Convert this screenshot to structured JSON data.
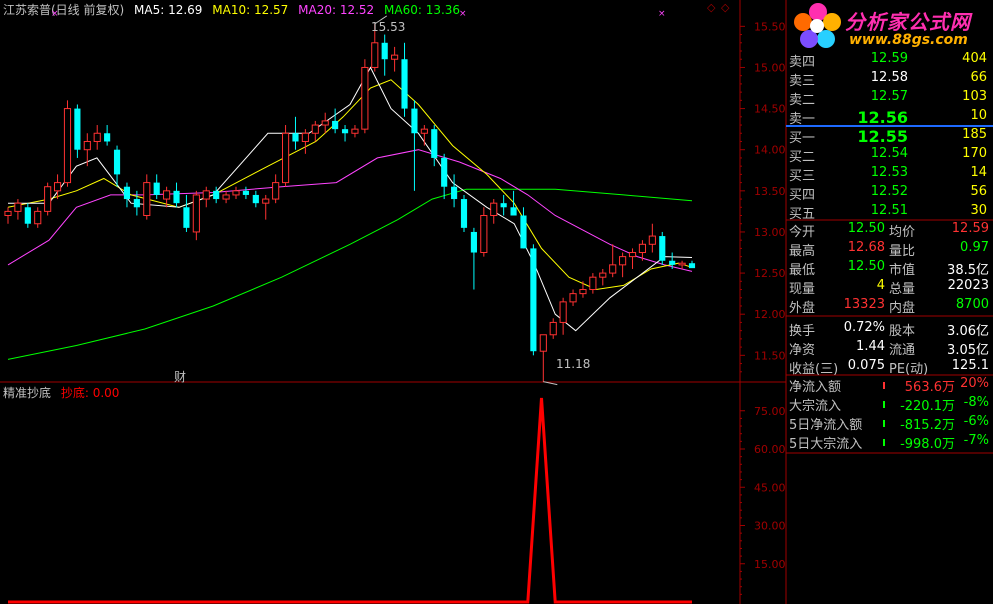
{
  "header": {
    "title": "江苏索普(日线 前复权)",
    "ma": [
      {
        "label": "MA5: 12.69",
        "color": "#ffffff"
      },
      {
        "label": "MA10: 12.57",
        "color": "#ffff00"
      },
      {
        "label": "MA20: 12.52",
        "color": "#ff44ff"
      },
      {
        "label": "MA60: 13.36",
        "color": "#00ff00"
      }
    ]
  },
  "indicator": {
    "name": "精准抄底",
    "line_label": "抄底: 0.00"
  },
  "colors": {
    "up": "#ff3232",
    "down": "#00ffff",
    "ma5": "#ffffff",
    "ma10": "#ffff00",
    "ma20": "#ff44ff",
    "ma60": "#00ff00",
    "axis": "#a00000",
    "ind": "#ff0000"
  },
  "annotations": {
    "high": "15.53",
    "low": "11.18",
    "marker": "财",
    "star": "×"
  },
  "logo": {
    "name": "分析家公式网",
    "url": "www.88gs.com"
  },
  "order_book": {
    "sell": [
      {
        "label": "卖四",
        "price": "12.59",
        "vol": "404"
      },
      {
        "label": "卖三",
        "price": "12.58",
        "vol": "66"
      },
      {
        "label": "卖二",
        "price": "12.57",
        "vol": "103"
      },
      {
        "label": "卖一",
        "price": "12.56",
        "vol": "10"
      }
    ],
    "buy": [
      {
        "label": "买一",
        "price": "12.55",
        "vol": "185"
      },
      {
        "label": "买二",
        "price": "12.54",
        "vol": "170"
      },
      {
        "label": "买三",
        "price": "12.53",
        "vol": "14"
      },
      {
        "label": "买四",
        "price": "12.52",
        "vol": "56"
      },
      {
        "label": "买五",
        "price": "12.51",
        "vol": "30"
      }
    ]
  },
  "quote": [
    {
      "l1": "今开",
      "v1": "12.50",
      "c1": "#00ff00",
      "l2": "均价",
      "v2": "12.59",
      "c2": "#ff3232"
    },
    {
      "l1": "最高",
      "v1": "12.68",
      "c1": "#ff3232",
      "l2": "量比",
      "v2": "0.97",
      "c2": "#00ff00"
    },
    {
      "l1": "最低",
      "v1": "12.50",
      "c1": "#00ff00",
      "l2": "市值",
      "v2": "38.5亿",
      "c2": "#ffffff"
    },
    {
      "l1": "现量",
      "v1": "4",
      "c1": "#ffff00",
      "l2": "总量",
      "v2": "22023",
      "c2": "#ffffff"
    },
    {
      "l1": "外盘",
      "v1": "13323",
      "c1": "#ff3232",
      "l2": "内盘",
      "v2": "8700",
      "c2": "#00ff00"
    },
    {
      "l1": "换手",
      "v1": "0.72%",
      "c1": "#ffffff",
      "l2": "股本",
      "v2": "3.06亿",
      "c2": "#ffffff"
    },
    {
      "l1": "净资",
      "v1": "1.44",
      "c1": "#ffffff",
      "l2": "流通",
      "v2": "3.05亿",
      "c2": "#ffffff"
    },
    {
      "l1": "收益(三)",
      "v1": "0.075",
      "c1": "#ffffff",
      "l2": "PE(动)",
      "v2": "125.1",
      "c2": "#ffffff"
    }
  ],
  "fund_flow": [
    {
      "label": "净流入额",
      "value": "563.6万",
      "pct": "20%",
      "color": "#ff3232"
    },
    {
      "label": "大宗流入",
      "value": "-220.1万",
      "pct": "-8%",
      "color": "#00ff00"
    },
    {
      "label": "5日净流入额",
      "value": "-815.2万",
      "pct": "-6%",
      "color": "#00ff00"
    },
    {
      "label": "5日大宗流入",
      "value": "-998.0万",
      "pct": "-7%",
      "color": "#00ff00"
    }
  ],
  "chart_data": [
    {
      "type": "candlestick",
      "y_ticks": [
        "15.50",
        "15.00",
        "14.50",
        "14.00",
        "13.50",
        "13.00",
        "12.50",
        "12.00",
        "11.50"
      ],
      "ylim": [
        11.2,
        15.65
      ],
      "candles": [
        [
          13.2,
          13.3,
          13.1,
          13.25
        ],
        [
          13.25,
          13.4,
          13.15,
          13.35
        ],
        [
          13.3,
          13.35,
          13.05,
          13.1
        ],
        [
          13.1,
          13.3,
          13.05,
          13.25
        ],
        [
          13.25,
          13.6,
          13.2,
          13.55
        ],
        [
          13.5,
          13.7,
          13.4,
          13.6
        ],
        [
          13.6,
          14.6,
          13.55,
          14.5
        ],
        [
          14.5,
          14.55,
          13.9,
          14.0
        ],
        [
          14.0,
          14.2,
          13.8,
          14.1
        ],
        [
          14.1,
          14.3,
          14.0,
          14.2
        ],
        [
          14.2,
          14.3,
          14.05,
          14.1
        ],
        [
          14.0,
          14.05,
          13.55,
          13.7
        ],
        [
          13.55,
          13.6,
          13.3,
          13.4
        ],
        [
          13.4,
          13.5,
          13.2,
          13.3
        ],
        [
          13.2,
          13.7,
          13.15,
          13.6
        ],
        [
          13.6,
          13.7,
          13.4,
          13.45
        ],
        [
          13.4,
          13.55,
          13.3,
          13.5
        ],
        [
          13.5,
          13.6,
          13.3,
          13.35
        ],
        [
          13.3,
          13.45,
          13.0,
          13.05
        ],
        [
          13.0,
          13.5,
          12.9,
          13.45
        ],
        [
          13.4,
          13.55,
          13.3,
          13.5
        ],
        [
          13.5,
          13.55,
          13.35,
          13.4
        ],
        [
          13.4,
          13.5,
          13.35,
          13.45
        ],
        [
          13.45,
          13.55,
          13.4,
          13.5
        ],
        [
          13.5,
          13.55,
          13.4,
          13.45
        ],
        [
          13.45,
          13.5,
          13.3,
          13.35
        ],
        [
          13.35,
          13.45,
          13.15,
          13.4
        ],
        [
          13.4,
          13.7,
          13.35,
          13.6
        ],
        [
          13.6,
          14.3,
          13.55,
          14.2
        ],
        [
          14.2,
          14.4,
          14.0,
          14.1
        ],
        [
          14.1,
          14.25,
          13.95,
          14.2
        ],
        [
          14.2,
          14.35,
          14.1,
          14.3
        ],
        [
          14.3,
          14.45,
          14.2,
          14.35
        ],
        [
          14.35,
          14.5,
          14.2,
          14.25
        ],
        [
          14.25,
          14.3,
          14.1,
          14.2
        ],
        [
          14.2,
          14.3,
          14.15,
          14.25
        ],
        [
          14.25,
          15.1,
          14.2,
          15.0
        ],
        [
          15.0,
          15.53,
          14.95,
          15.3
        ],
        [
          15.3,
          15.4,
          14.9,
          15.1
        ],
        [
          15.1,
          15.25,
          14.95,
          15.15
        ],
        [
          15.1,
          15.3,
          14.4,
          14.5
        ],
        [
          14.5,
          14.6,
          13.5,
          14.2
        ],
        [
          14.2,
          14.3,
          14.05,
          14.25
        ],
        [
          14.25,
          14.3,
          13.8,
          13.9
        ],
        [
          13.9,
          13.95,
          13.4,
          13.55
        ],
        [
          13.55,
          13.7,
          13.3,
          13.4
        ],
        [
          13.4,
          13.45,
          13.0,
          13.05
        ],
        [
          13.0,
          13.05,
          12.3,
          12.75
        ],
        [
          12.75,
          13.3,
          12.7,
          13.2
        ],
        [
          13.2,
          13.4,
          13.1,
          13.35
        ],
        [
          13.35,
          13.45,
          13.2,
          13.3
        ],
        [
          13.3,
          13.5,
          13.2,
          13.2
        ],
        [
          13.2,
          13.3,
          12.8,
          12.8
        ],
        [
          12.8,
          12.85,
          11.5,
          11.55
        ],
        [
          11.55,
          11.75,
          11.18,
          11.75
        ],
        [
          11.75,
          11.95,
          11.7,
          11.9
        ],
        [
          11.9,
          12.2,
          11.75,
          12.15
        ],
        [
          12.15,
          12.3,
          12.1,
          12.25
        ],
        [
          12.25,
          12.4,
          12.2,
          12.3
        ],
        [
          12.3,
          12.5,
          12.25,
          12.45
        ],
        [
          12.45,
          12.55,
          12.35,
          12.5
        ],
        [
          12.5,
          12.85,
          12.45,
          12.6
        ],
        [
          12.6,
          12.75,
          12.45,
          12.7
        ],
        [
          12.7,
          12.8,
          12.55,
          12.75
        ],
        [
          12.75,
          12.9,
          12.65,
          12.85
        ],
        [
          12.85,
          13.1,
          12.75,
          12.95
        ],
        [
          12.95,
          13.0,
          12.6,
          12.65
        ],
        [
          12.65,
          12.75,
          12.55,
          12.6
        ],
        [
          12.6,
          12.65,
          12.55,
          12.62
        ],
        [
          12.62,
          12.65,
          12.58,
          12.56
        ]
      ],
      "ma60": [
        [
          0,
          11.45
        ],
        [
          10,
          11.62
        ],
        [
          20,
          11.82
        ],
        [
          30,
          12.1
        ],
        [
          40,
          12.45
        ],
        [
          50,
          12.85
        ],
        [
          57,
          13.15
        ],
        [
          62,
          13.4
        ],
        [
          67,
          13.52
        ],
        [
          80,
          13.52
        ],
        [
          90,
          13.45
        ],
        [
          100,
          13.38
        ]
      ],
      "ma20": [
        [
          0,
          12.6
        ],
        [
          6,
          12.9
        ],
        [
          10,
          13.3
        ],
        [
          15,
          13.45
        ],
        [
          20,
          13.45
        ],
        [
          30,
          13.48
        ],
        [
          40,
          13.55
        ],
        [
          48,
          13.6
        ],
        [
          54,
          13.9
        ],
        [
          60,
          14.0
        ],
        [
          66,
          13.85
        ],
        [
          72,
          13.65
        ],
        [
          76,
          13.45
        ],
        [
          80,
          13.2
        ],
        [
          88,
          12.85
        ],
        [
          92,
          12.7
        ],
        [
          96,
          12.6
        ],
        [
          100,
          12.52
        ]
      ],
      "ma10": [
        [
          0,
          13.3
        ],
        [
          6,
          13.4
        ],
        [
          10,
          13.5
        ],
        [
          14,
          13.65
        ],
        [
          18,
          13.45
        ],
        [
          25,
          13.3
        ],
        [
          30,
          13.45
        ],
        [
          38,
          13.8
        ],
        [
          45,
          14.1
        ],
        [
          49,
          14.4
        ],
        [
          53,
          14.75
        ],
        [
          56,
          14.85
        ],
        [
          60,
          14.55
        ],
        [
          65,
          14.05
        ],
        [
          70,
          13.7
        ],
        [
          74,
          13.35
        ],
        [
          78,
          12.8
        ],
        [
          82,
          12.45
        ],
        [
          86,
          12.3
        ],
        [
          90,
          12.35
        ],
        [
          94,
          12.55
        ],
        [
          98,
          12.62
        ],
        [
          100,
          12.57
        ]
      ],
      "ma5": [
        [
          0,
          13.35
        ],
        [
          6,
          13.35
        ],
        [
          10,
          13.8
        ],
        [
          13,
          13.9
        ],
        [
          18,
          13.35
        ],
        [
          25,
          13.3
        ],
        [
          30,
          13.45
        ],
        [
          38,
          14.2
        ],
        [
          44,
          14.2
        ],
        [
          50,
          14.55
        ],
        [
          53,
          15.0
        ],
        [
          56,
          14.5
        ],
        [
          60,
          14.2
        ],
        [
          65,
          13.6
        ],
        [
          70,
          13.3
        ],
        [
          74,
          13.1
        ],
        [
          77,
          12.6
        ],
        [
          80,
          12.0
        ],
        [
          83,
          11.8
        ],
        [
          88,
          12.2
        ],
        [
          92,
          12.45
        ],
        [
          96,
          12.7
        ],
        [
          100,
          12.69
        ]
      ]
    },
    {
      "type": "line",
      "y_ticks": [
        "75.00",
        "60.00",
        "45.00",
        "30.00",
        "15.00"
      ],
      "ylim": [
        0,
        80
      ],
      "series": [
        {
          "values": [
            [
              0,
              0
            ],
            [
              76,
              0
            ],
            [
              78,
              80
            ],
            [
              80,
              0
            ],
            [
              100,
              0
            ]
          ]
        }
      ]
    }
  ]
}
